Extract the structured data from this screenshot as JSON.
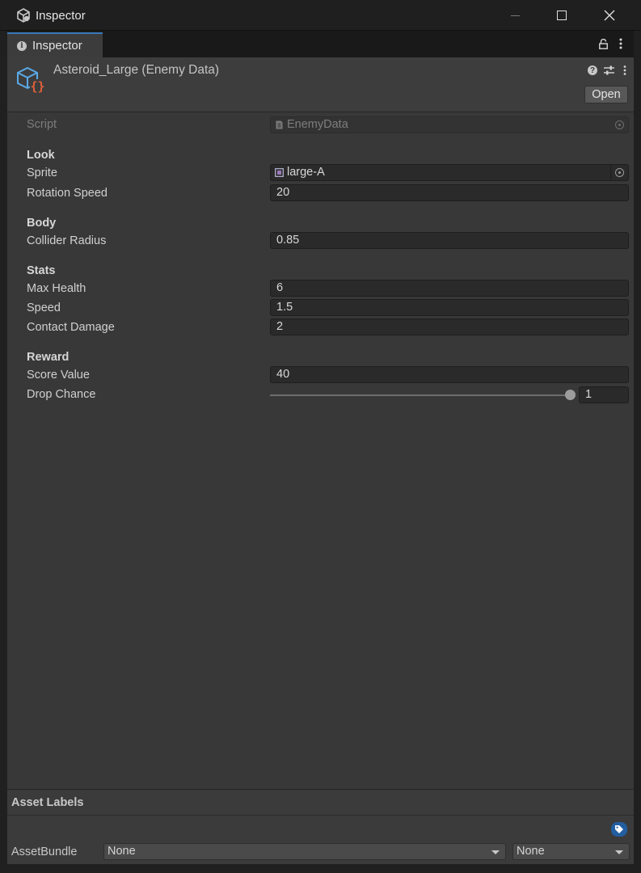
{
  "window": {
    "title": "Inspector",
    "controls": [
      "minimize",
      "maximize",
      "close"
    ]
  },
  "tab": {
    "label": "Inspector"
  },
  "header": {
    "asset_title": "Asteroid_Large (Enemy Data)",
    "open_label": "Open"
  },
  "script": {
    "label": "Script",
    "value": "EnemyData"
  },
  "sections": {
    "look": "Look",
    "body": "Body",
    "stats": "Stats",
    "reward": "Reward"
  },
  "fields": {
    "sprite": {
      "label": "Sprite",
      "value": "large-A"
    },
    "rotation_speed": {
      "label": "Rotation Speed",
      "value": "20"
    },
    "collider_radius": {
      "label": "Collider Radius",
      "value": "0.85"
    },
    "max_health": {
      "label": "Max Health",
      "value": "6"
    },
    "speed": {
      "label": "Speed",
      "value": "1.5"
    },
    "contact_damage": {
      "label": "Contact Damage",
      "value": "2"
    },
    "score_value": {
      "label": "Score Value",
      "value": "40"
    },
    "drop_chance": {
      "label": "Drop Chance",
      "value": "1",
      "slider_fraction": 1.0
    }
  },
  "asset_labels": {
    "title": "Asset Labels",
    "assetbundle_label": "AssetBundle",
    "bundle_name": "None",
    "bundle_variant": "None"
  },
  "colors": {
    "panel_bg": "#383838",
    "accent_tab": "#3a79bb",
    "asset_icon_cube": "#5aa9e6",
    "asset_icon_braces": "#e0603a",
    "tag_badge": "#235ea0"
  }
}
